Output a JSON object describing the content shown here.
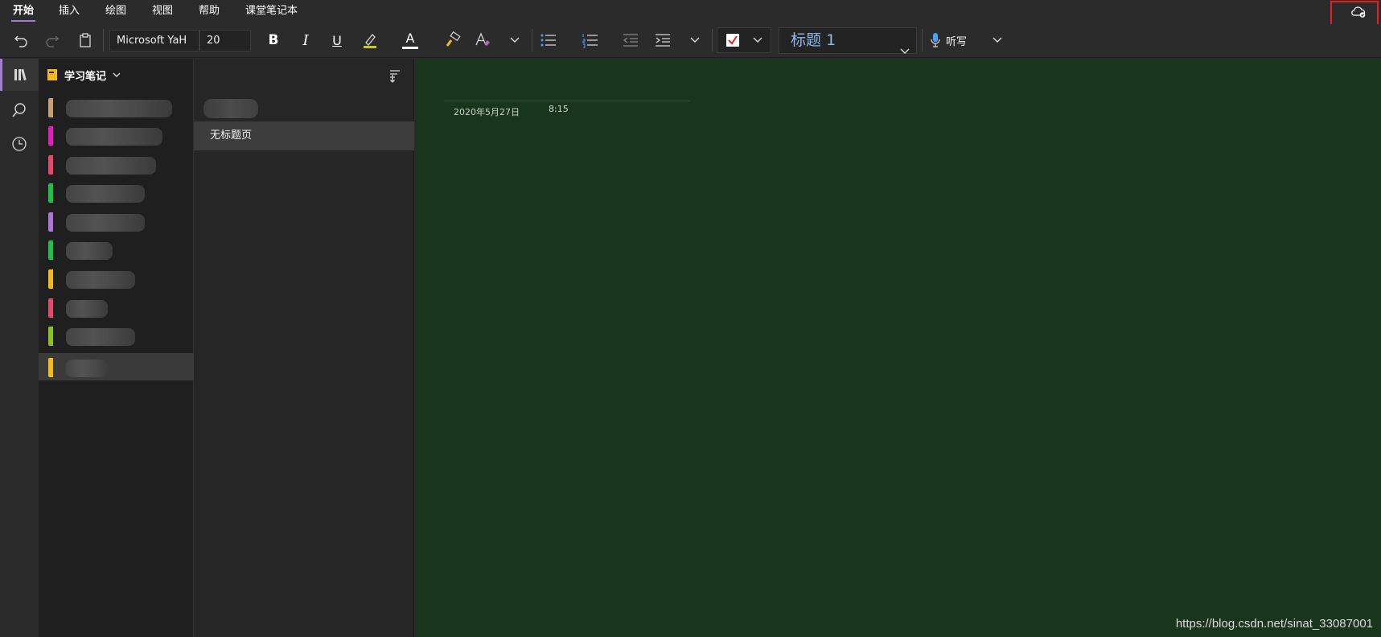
{
  "menu": {
    "items": [
      {
        "label": "开始",
        "active": true
      },
      {
        "label": "插入",
        "active": false
      },
      {
        "label": "绘图",
        "active": false
      },
      {
        "label": "视图",
        "active": false
      },
      {
        "label": "帮助",
        "active": false
      },
      {
        "label": "课堂笔记本",
        "active": false
      }
    ],
    "sync_icon": "cloud-sync-icon"
  },
  "toolbar": {
    "font_name": "Microsoft YaH",
    "font_size": "20",
    "bold_label": "B",
    "italic_label": "I",
    "underline_label": "U",
    "font_color_label": "A",
    "style_value": "标题 1",
    "dictate_label": "听写",
    "highlight_color": "#c8c820",
    "font_color": "#ffffff"
  },
  "rail": {
    "items": [
      "notebooks-icon",
      "search-icon",
      "recent-icon"
    ]
  },
  "notebook": {
    "name": "学习笔记",
    "sections": [
      {
        "color": "#c89e73"
      },
      {
        "color": "#e21dbf"
      },
      {
        "color": "#e24a6e"
      },
      {
        "color": "#1fbf4a"
      },
      {
        "color": "#b073d6"
      },
      {
        "color": "#1fbf4a"
      },
      {
        "color": "#f5b91c"
      },
      {
        "color": "#e24a6e"
      },
      {
        "color": "#8cc21c"
      },
      {
        "color": "#f5b91c",
        "selected": true
      }
    ]
  },
  "pages": {
    "items": [
      {
        "label": "无标题页",
        "selected": true
      }
    ]
  },
  "page": {
    "date": "2020年5月27日",
    "time": "8:15"
  },
  "watermark": "https://blog.csdn.net/sinat_33087001",
  "colors": {
    "accent": "#a67bd6",
    "canvas": "#19351c",
    "sync_highlight": "#e22222"
  }
}
